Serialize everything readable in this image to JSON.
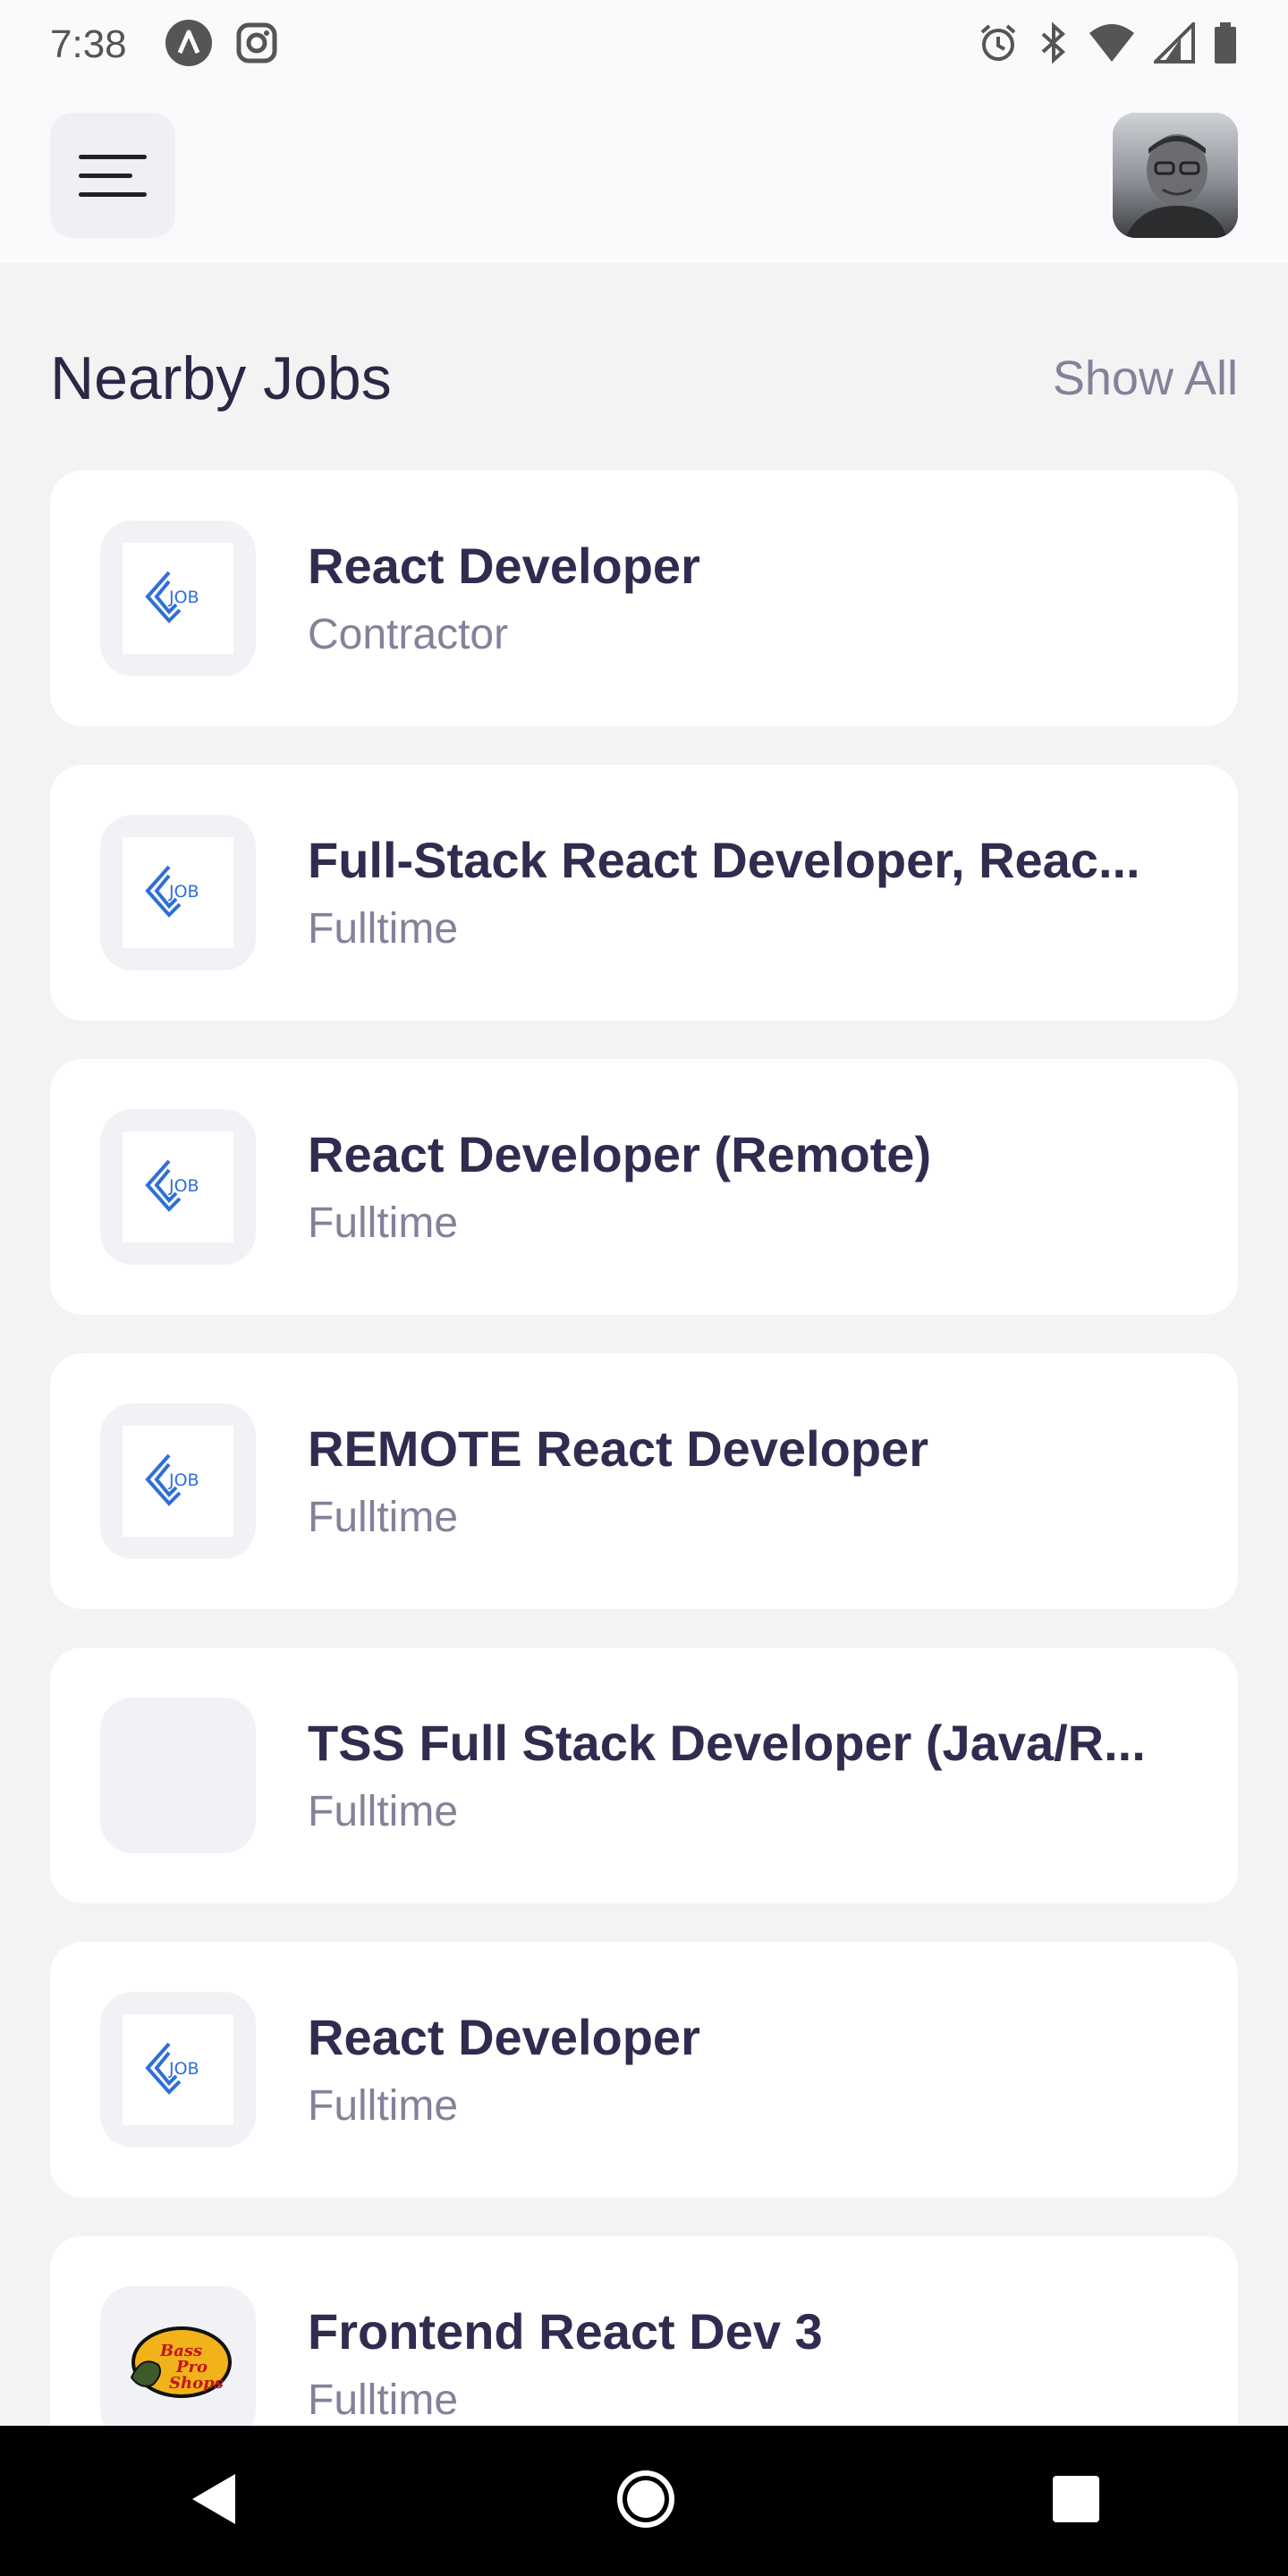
{
  "status_bar": {
    "time": "7:38",
    "left_icons": [
      "app-icon",
      "instagram-icon"
    ],
    "right_icons": [
      "alarm-icon",
      "bluetooth-icon",
      "wifi-icon",
      "signal-icon",
      "battery-icon"
    ]
  },
  "header": {
    "menu_icon": "hamburger-menu-icon",
    "avatar": "user-avatar"
  },
  "section": {
    "title": "Nearby Jobs",
    "show_all": "Show All"
  },
  "jobs": [
    {
      "title": "React Developer",
      "type": "Contractor",
      "logo": "job-logo"
    },
    {
      "title": "Full-Stack React Developer, Reac...",
      "type": "Fulltime",
      "logo": "job-logo"
    },
    {
      "title": "React Developer (Remote)",
      "type": "Fulltime",
      "logo": "job-logo"
    },
    {
      "title": "REMOTE React Developer",
      "type": "Fulltime",
      "logo": "job-logo"
    },
    {
      "title": "TSS Full Stack Developer (Java/R...",
      "type": "Fulltime",
      "logo": "none"
    },
    {
      "title": "React Developer",
      "type": "Fulltime",
      "logo": "job-logo"
    },
    {
      "title": "Frontend React Dev 3",
      "type": "Fulltime",
      "logo": "bass-pro-shops-logo",
      "logo_text": "Bass Pro Shops"
    }
  ],
  "nav_bar": {
    "icons": [
      "back-icon",
      "home-icon",
      "recents-icon"
    ]
  },
  "colors": {
    "background": "#f3f3f4",
    "card": "#ffffff",
    "title": "#312c4f",
    "subtitle": "#83829a",
    "accent": "#2f6fd6"
  }
}
